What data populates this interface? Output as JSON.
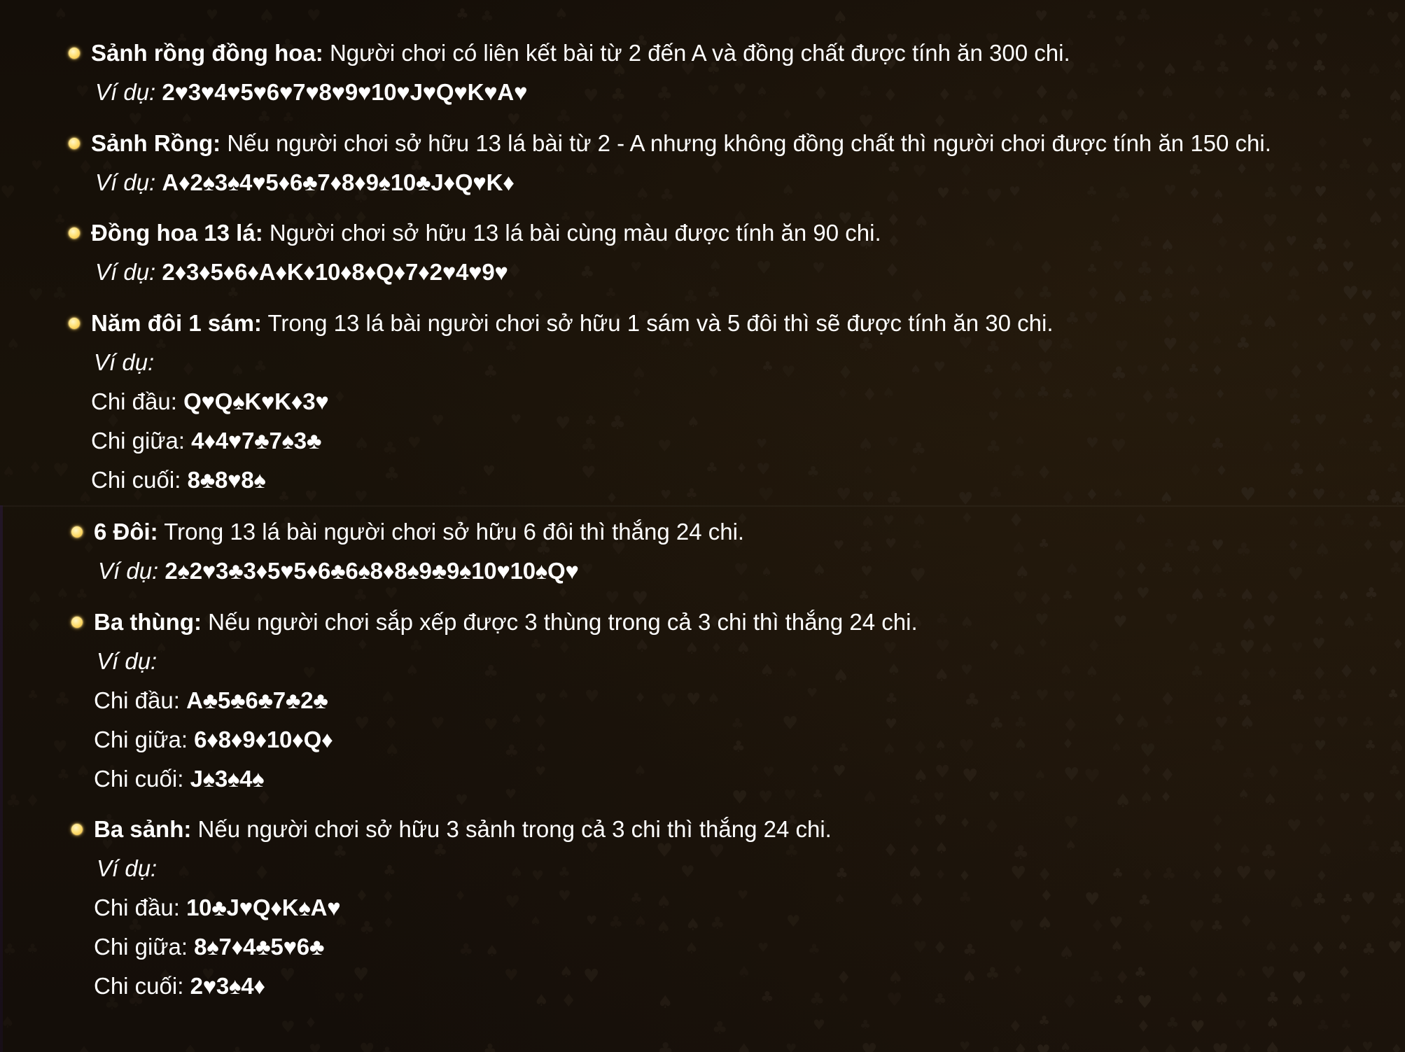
{
  "example_label": "Ví dụ:",
  "rules": [
    {
      "title": "Sảnh rồng đồng hoa:",
      "description": " Người chơi có liên kết bài từ 2 đến A và đồng chất được tính ăn 300 chi.",
      "example_cards": "2♥3♥4♥5♥6♥7♥8♥9♥10♥J♥Q♥K♥A♥"
    },
    {
      "title": "Sảnh Rồng:",
      "description": " Nếu người chơi sở hữu 13 lá bài từ 2 - A nhưng không đồng chất thì người chơi được tính ăn 150 chi.",
      "example_cards": "A♦2♠3♠4♥5♦6♣7♦8♦9♠10♣J♦Q♥K♦"
    },
    {
      "title": "Đồng hoa 13 lá:",
      "description": " Người chơi sở hữu 13 lá bài cùng màu được tính ăn 90 chi.",
      "example_cards": "2♦3♦5♦6♦A♦K♦10♦8♦Q♦7♦2♥4♥9♥"
    },
    {
      "title": "Năm đôi 1 sám:",
      "description": " Trong 13 lá bài người chơi sở hữu 1 sám và 5 đôi thì sẽ được tính ăn 30 chi.",
      "rows": [
        {
          "label": "Chi đầu: ",
          "cards": "Q♥Q♠K♥K♦3♥"
        },
        {
          "label": "Chi giữa: ",
          "cards": "4♦4♥7♣7♠3♣"
        },
        {
          "label": "Chi cuối: ",
          "cards": "8♣8♥8♠"
        }
      ]
    },
    {
      "title": "6 Đôi:",
      "description": " Trong 13 lá bài người chơi sở hữu 6 đôi thì thắng 24 chi.",
      "example_cards": "2♠2♥3♣3♦5♥5♦6♣6♠8♦8♠9♣9♠10♥10♠Q♥"
    },
    {
      "title": "Ba thùng:",
      "description": " Nếu người chơi sắp xếp được 3 thùng trong cả 3 chi thì thắng 24 chi.",
      "rows": [
        {
          "label": "Chi đầu: ",
          "cards": "A♣5♣6♣7♣2♣"
        },
        {
          "label": "Chi giữa: ",
          "cards": "6♦8♦9♦10♦Q♦"
        },
        {
          "label": "Chi cuối: ",
          "cards": "J♠3♠4♠"
        }
      ]
    },
    {
      "title": "Ba sảnh:",
      "description": " Nếu người chơi sở hữu 3 sảnh trong cả 3 chi thì thắng 24 chi.",
      "rows": [
        {
          "label": "Chi đầu: ",
          "cards": "10♣J♥Q♦K♠A♥"
        },
        {
          "label": "Chi giữa: ",
          "cards": "8♠7♦4♣5♥6♣"
        },
        {
          "label": "Chi cuối: ",
          "cards": "2♥3♠4♦"
        }
      ]
    }
  ]
}
